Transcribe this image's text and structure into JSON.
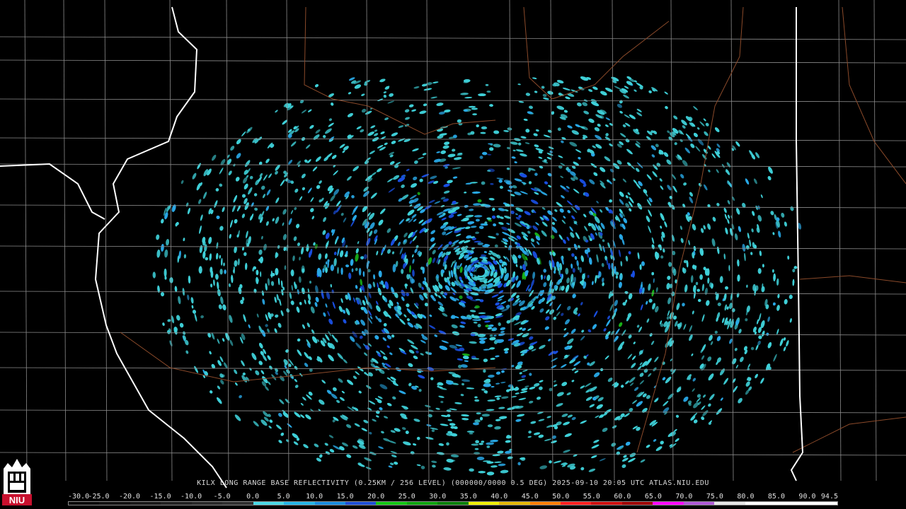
{
  "caption": {
    "text": "KILX LONG RANGE BASE REFLECTIVITY (0.25KM / 256 LEVEL) (000000/0000 0.5 DEG) 2025-09-10 20:05 UTC  ATLAS.NIU.EDU"
  },
  "logo": {
    "text": "NIU",
    "color": "#c8102e"
  },
  "legend": {
    "labels": [
      "-30.0",
      "-25.0",
      "-20.0",
      "-15.0",
      "-10.0",
      "-5.0",
      "0.0",
      "5.0",
      "10.0",
      "15.0",
      "20.0",
      "25.0",
      "30.0",
      "35.0",
      "40.0",
      "45.0",
      "50.0",
      "55.0",
      "60.0",
      "65.0",
      "70.0",
      "75.0",
      "80.0",
      "85.0",
      "90.0",
      "94.5"
    ],
    "colors": [
      "#0a0a0a",
      "#121212",
      "#1a1a1a",
      "#222222",
      "#2a2a2a",
      "#303030",
      "#4ad9e6",
      "#26b6e8",
      "#1a8de0",
      "#1f4fd8",
      "#14c814",
      "#0fa50f",
      "#0a820a",
      "#f0f000",
      "#e6b800",
      "#ff7f00",
      "#ff2020",
      "#d01010",
      "#a00000",
      "#ff00ff",
      "#b05ad8",
      "#e8e8e8",
      "#ffffff",
      "#ffffff",
      "#ffffff"
    ]
  },
  "map": {
    "radar_site": "KILX",
    "colors": {
      "state_border": "#ffffff",
      "county_border": "#8c8c8c",
      "highway": "#8b4a2a",
      "echo_light": "#3fd0d8",
      "echo_mid": "#29a8e6",
      "echo_strong": "#1a4fe0",
      "echo_green": "#18b018"
    }
  }
}
